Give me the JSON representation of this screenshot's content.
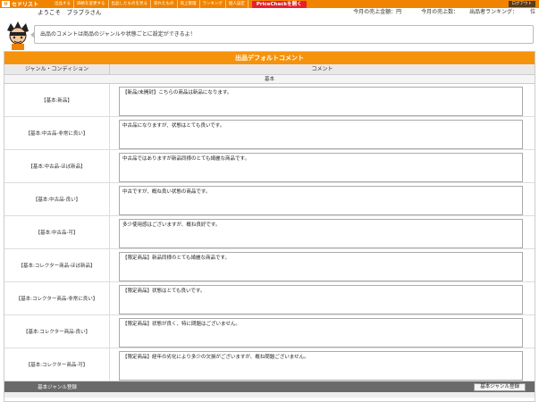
{
  "header": {
    "logo_mark": "せ",
    "logo_text": "セドリスト",
    "nav": [
      "出品する",
      "価格を変更する",
      "出品したものを見る",
      "売れたもの",
      "売上管理",
      "ランキング",
      "個人設定"
    ],
    "pricecheck": "PriceCheckを開く",
    "logout": "ログアウト"
  },
  "welcome": "ようこそ　ブラブラさん",
  "stats": {
    "sales_amount": "今月の売上金額：円",
    "sales_count": "今月の売上数：",
    "ranking": "出品者ランキング：",
    "ranking_suffix": "位"
  },
  "speech": "出品のコメントは商品のジャンルや状態ごとに設定ができるよ！",
  "panel": {
    "title": "出品デフォルトコメント",
    "col_condition": "ジャンル・コンディション",
    "col_comment": "コメント",
    "section": "基本",
    "rows": [
      {
        "label": "【基本:新品】",
        "comment": "【新品/未開封】こちらの商品は新品になります。"
      },
      {
        "label": "【基本:中古品-非常に良い】",
        "comment": "中古品になりますが、状態はとても良いです。"
      },
      {
        "label": "【基本:中古品-ほぼ新品】",
        "comment": "中古品ではありますが新品同様のとても綺麗な商品です。"
      },
      {
        "label": "【基本:中古品-良い】",
        "comment": "中古ですが、概ね良い状態の商品です。"
      },
      {
        "label": "【基本:中古品-可】",
        "comment": "多少使用感はございますが、概ね良好です。"
      },
      {
        "label": "【基本:コレクター商品-ほぼ新品】",
        "comment": "【限定商品】新品同様のとても綺麗な商品です。"
      },
      {
        "label": "【基本:コレクター商品-非常に良い】",
        "comment": "【限定商品】状態はとても良いです。"
      },
      {
        "label": "【基本:コレクター商品-良い】",
        "comment": "【限定商品】状態が良く、特に問題はございません。"
      },
      {
        "label": "【基本:コレクター商品-可】",
        "comment": "【限定商品】経年の劣化により多少の欠損がございますが、概ね問題ございません。"
      }
    ],
    "footer_label": "基本ジャンル登録",
    "footer_button": "基本ジャンル登録"
  },
  "colors": {
    "accent": "#f08300",
    "panel_head": "#f5930d",
    "pricecheck": "#e8202a"
  }
}
